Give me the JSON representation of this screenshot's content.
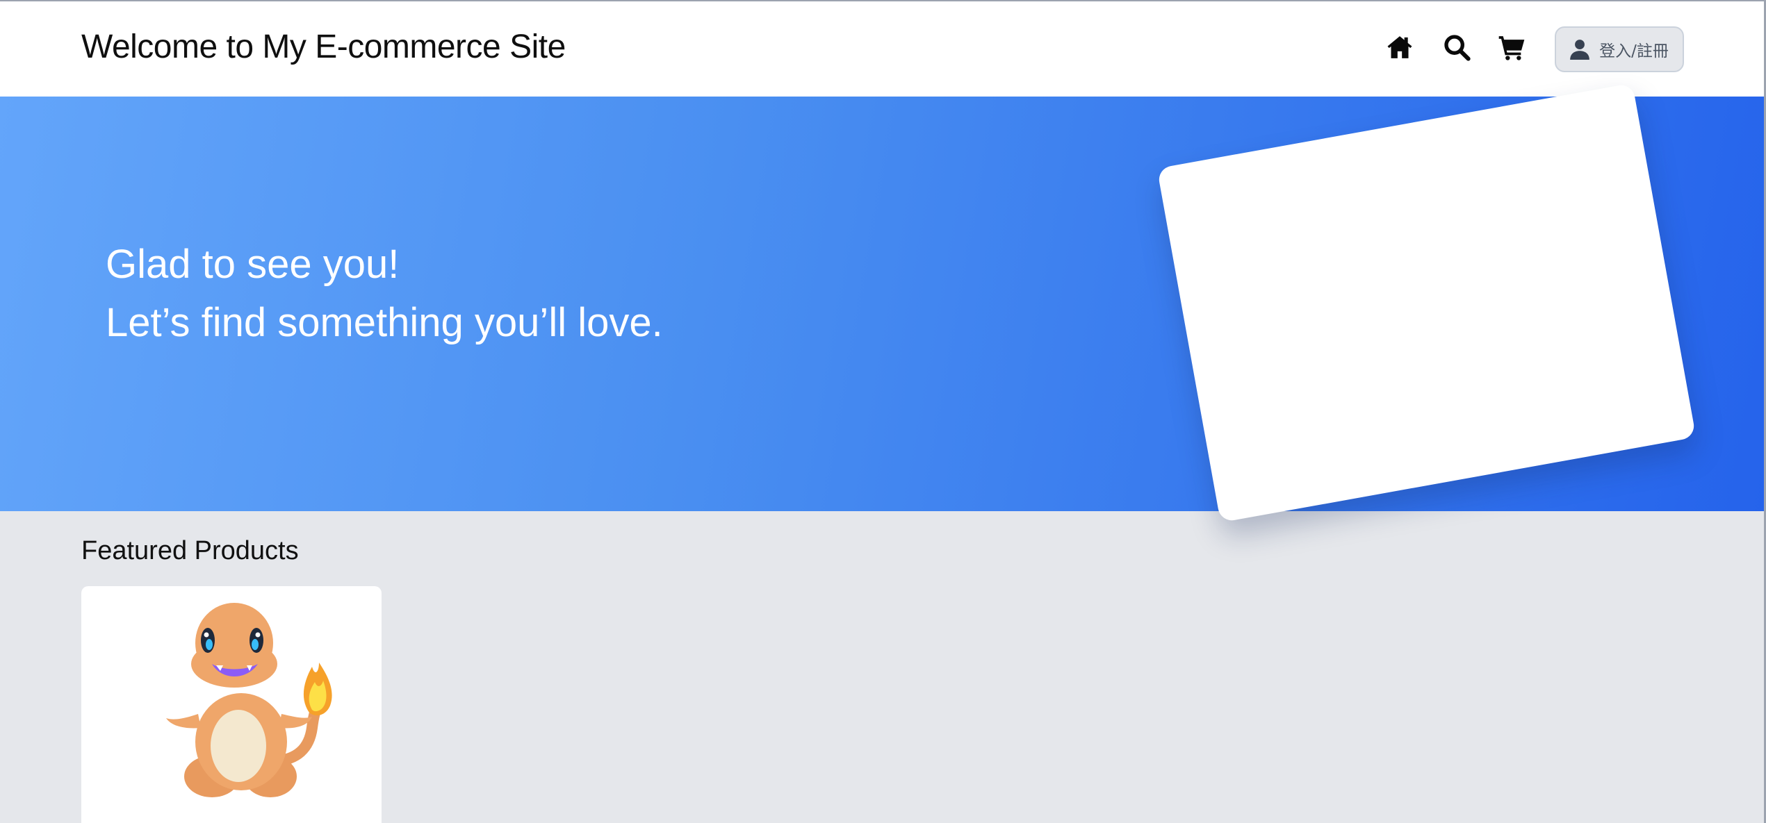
{
  "header": {
    "title": "Welcome to My E-commerce Site",
    "nav": [
      {
        "icon": "home-icon"
      },
      {
        "icon": "search-icon"
      },
      {
        "icon": "cart-icon"
      }
    ],
    "login_label": "登入/註冊",
    "login_icon": "user-icon"
  },
  "hero": {
    "line1": "Glad to see you!",
    "line2": "Let’s find something you’ll love.",
    "colors": {
      "from": "#63a5fa",
      "to": "#2563eb"
    }
  },
  "featured": {
    "title": "Featured Products",
    "products": [
      {
        "image": "charmander-image"
      }
    ]
  }
}
